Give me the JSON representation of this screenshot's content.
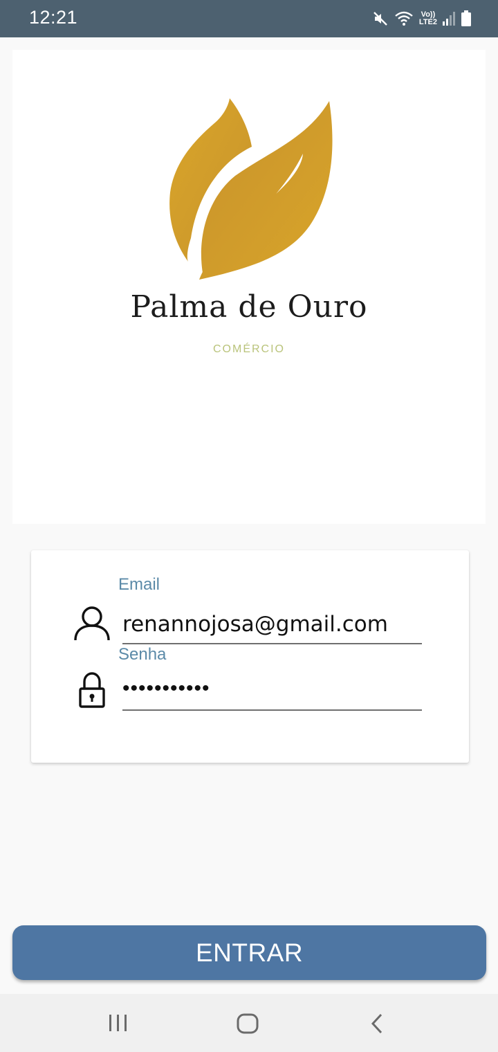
{
  "status_bar": {
    "time": "12:21",
    "volte_top": "Vo))",
    "volte_bottom": "LTE2",
    "icons": [
      "mute-icon",
      "wifi-icon",
      "volte-icon",
      "signal-icon",
      "battery-icon"
    ]
  },
  "logo": {
    "brand_name": "Palma de Ouro",
    "tagline": "COMÉRCIO",
    "leaf_color": "#d4a32a"
  },
  "form": {
    "email_label": "Email",
    "email_value": "renannojosa@gmail.com",
    "password_label": "Senha",
    "password_mask": "•••••••••••",
    "label_color": "#5b8aa8"
  },
  "submit_button": {
    "label": "ENTRAR",
    "color": "#4e76a3"
  },
  "nav_bar": {
    "icons": [
      "recent-apps-icon",
      "home-icon",
      "back-icon"
    ]
  }
}
